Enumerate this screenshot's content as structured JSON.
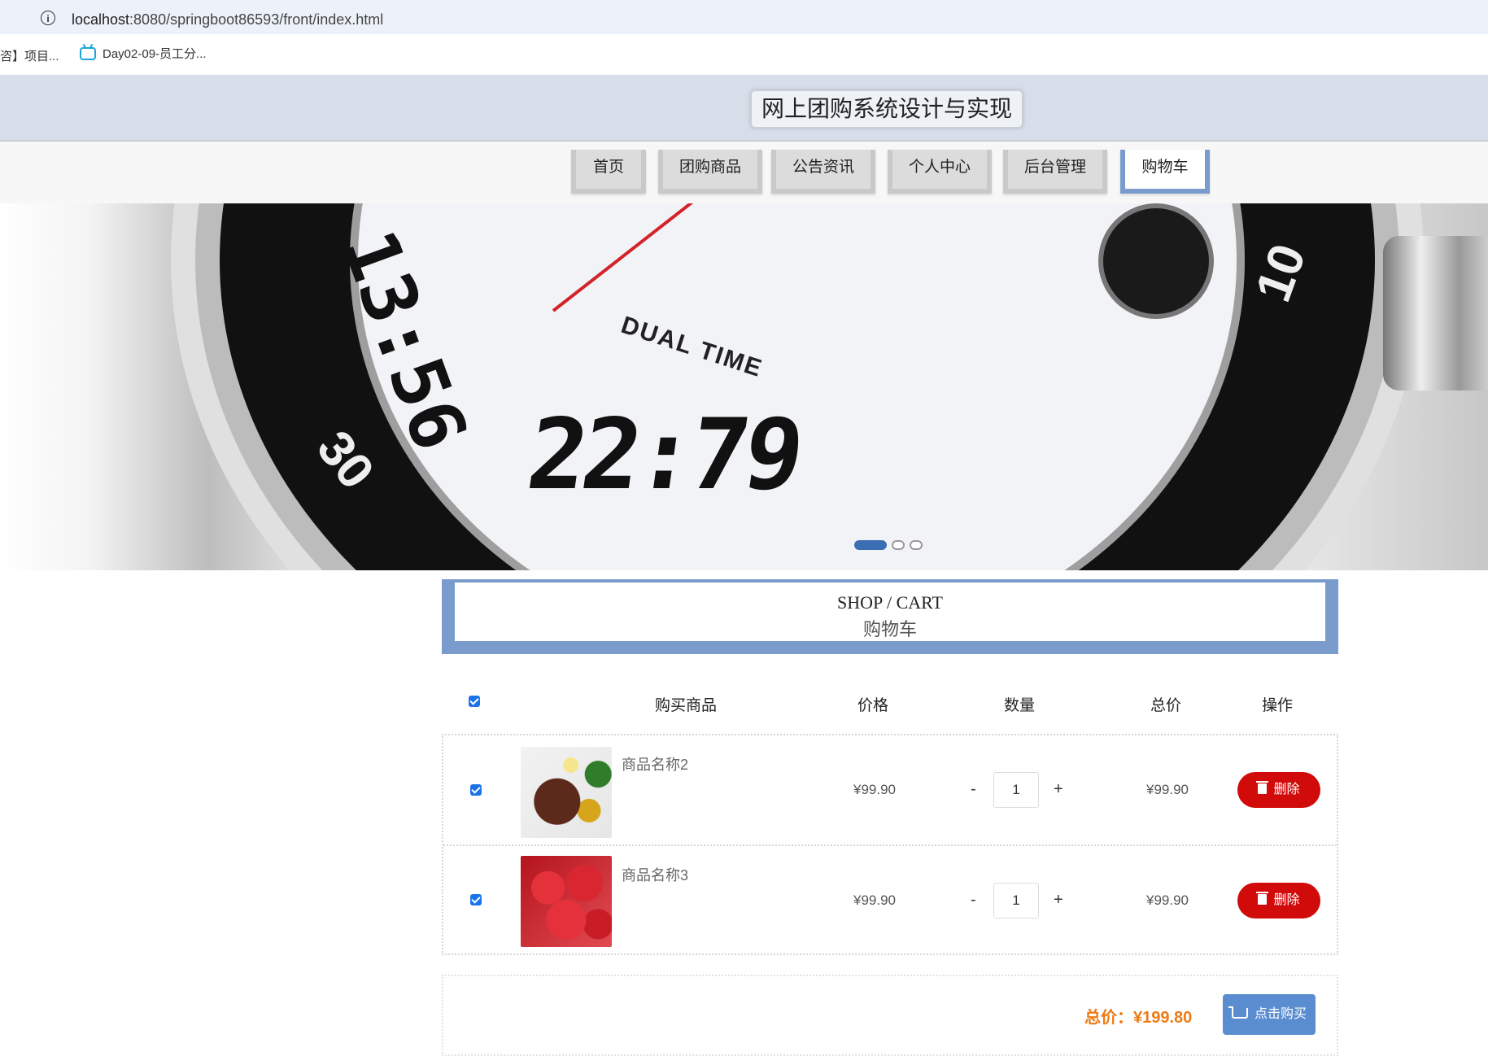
{
  "browser": {
    "url_host": "localhost",
    "url_rest": ":8080/springboot86593/front/index.html",
    "bookmarks": [
      {
        "label": "咨】项目..."
      },
      {
        "label": "Day02-09-员工分..."
      }
    ]
  },
  "header": {
    "site_title": "网上团购系统设计与实现"
  },
  "nav": {
    "items": [
      {
        "label": "首页"
      },
      {
        "label": "团购商品"
      },
      {
        "label": "公告资讯"
      },
      {
        "label": "个人中心"
      },
      {
        "label": "后台管理"
      },
      {
        "label": "购物车"
      }
    ],
    "active_index": 5
  },
  "banner": {
    "big_digits": "22:79",
    "small_digits": "13:56",
    "dial_text": "DUAL TIME",
    "bezel_num_left": "30",
    "bezel_num_right": "10",
    "slide_count": 3,
    "active_slide": 0
  },
  "section": {
    "title_en": "SHOP / CART",
    "title_zh": "购物车"
  },
  "cart": {
    "headers": {
      "product": "购买商品",
      "price": "价格",
      "quantity": "数量",
      "total": "总价",
      "action": "操作"
    },
    "items": [
      {
        "name": "商品名称2",
        "price": "¥99.90",
        "quantity": "1",
        "total": "¥99.90",
        "checked": true,
        "thumb": "food"
      },
      {
        "name": "商品名称3",
        "price": "¥99.90",
        "quantity": "1",
        "total": "¥99.90",
        "checked": true,
        "thumb": "cherry"
      }
    ],
    "minus_label": "-",
    "plus_label": "+",
    "delete_label": "删除",
    "grand_total_label": "总价：",
    "grand_total_value": "¥199.80",
    "buy_label": "点击购买"
  },
  "colors": {
    "accent_blue": "#7a9ccc",
    "delete_red": "#d10a0a",
    "total_orange": "#ef7a14",
    "buy_blue": "#5a8dd0"
  }
}
